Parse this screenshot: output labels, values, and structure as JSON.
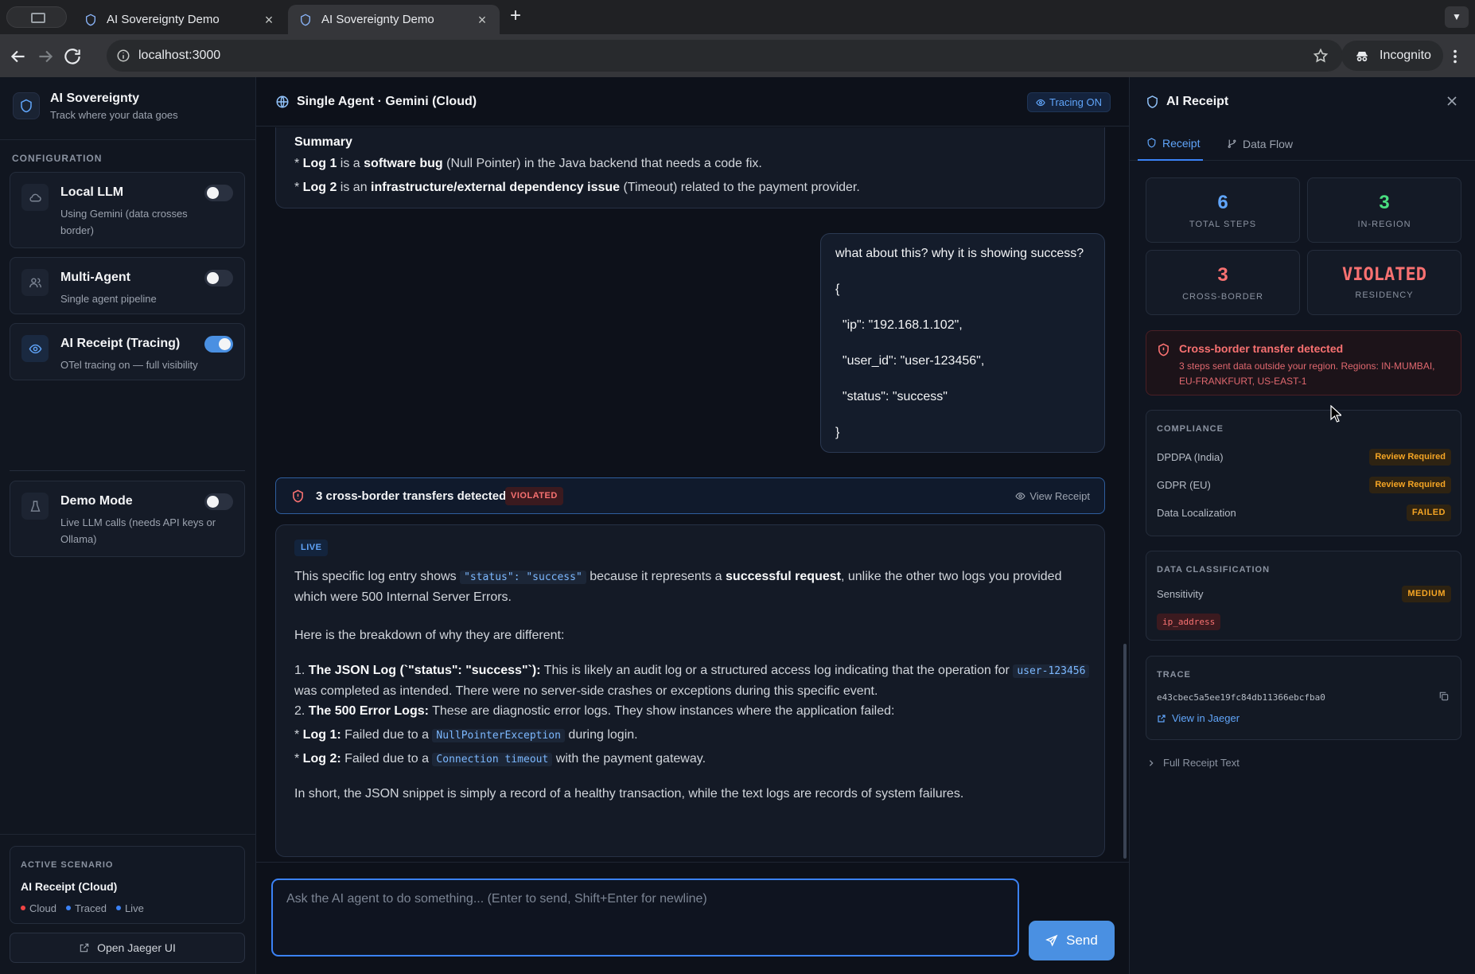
{
  "browser": {
    "tabs": [
      {
        "title": "AI Sovereignty Demo",
        "active": false
      },
      {
        "title": "AI Sovereignty Demo",
        "active": true
      }
    ],
    "url": "localhost:3000",
    "incognito_label": "Incognito"
  },
  "sidebar": {
    "brand_title": "AI Sovereignty",
    "brand_subtitle": "Track where your data goes",
    "section_label": "CONFIGURATION",
    "items": [
      {
        "title": "Local LLM",
        "desc": "Using Gemini (data crosses border)",
        "enabled": false,
        "icon": "cloud-icon"
      },
      {
        "title": "Multi-Agent",
        "desc": "Single agent pipeline",
        "enabled": false,
        "icon": "users-icon"
      },
      {
        "title": "AI Receipt (Tracing)",
        "desc": "OTel tracing on — full visibility",
        "enabled": true,
        "icon": "eye-icon"
      },
      {
        "title": "Demo Mode",
        "desc": "Live LLM calls (needs API keys or Ollama)",
        "enabled": false,
        "icon": "flask-icon"
      }
    ],
    "scenario": {
      "label": "ACTIVE SCENARIO",
      "name": "AI Receipt (Cloud)",
      "tags": [
        "Cloud",
        "Traced",
        "Live"
      ]
    },
    "jaeger_button": "Open Jaeger UI"
  },
  "main": {
    "header_title": "Single Agent · Gemini (Cloud)",
    "tracing_badge": "Tracing ON",
    "top_message": {
      "heading": "Summary",
      "line1_prefix": "* ",
      "line1_b1": "Log 1",
      "line1_t1": " is a ",
      "line1_b2": "software bug",
      "line1_t2": " (Null Pointer) in the Java backend that needs a code fix.",
      "line2_prefix": "* ",
      "line2_b1": "Log 2",
      "line2_t1": " is an ",
      "line2_b2": "infrastructure/external dependency issue",
      "line2_t2": " (Timeout) related to the payment provider."
    },
    "user_message_lines": [
      "what about this? why it is showing success?",
      "{",
      "  \"ip\": \"192.168.1.102\",",
      "  \"user_id\": \"user-123456\",",
      "  \"status\": \"success\"",
      "}"
    ],
    "alert": {
      "text": "3 cross-border transfers detected",
      "badge": "VIOLATED",
      "action": "View Receipt"
    },
    "ai_message": {
      "badge": "LIVE",
      "p1_a": "This specific log entry shows ",
      "p1_code": "\"status\": \"success\"",
      "p1_b": " because it represents a ",
      "p1_bold": "successful request",
      "p1_c": ", unlike the other two logs you provided which were 500 Internal Server Errors.",
      "p2": "Here is the breakdown of why they are different:",
      "p3_num": "1. ",
      "p3_bold": "The JSON Log (`\"status\": \"success\"`):",
      "p3_a": " This is likely an audit log or a structured access log indicating that the operation for ",
      "p3_code": "user-123456",
      "p3_b": " was completed as intended. There were no server-side crashes or exceptions during this specific event.",
      "p4_num": "2. ",
      "p4_bold": "The 500 Error Logs:",
      "p4_a": " These are diagnostic error logs. They show instances where the application failed:",
      "p5_prefix": "* ",
      "p5_bold": "Log 1:",
      "p5_a": " Failed due to a ",
      "p5_code": "NullPointerException",
      "p5_b": " during login.",
      "p6_prefix": "* ",
      "p6_bold": "Log 2:",
      "p6_a": " Failed due to a ",
      "p6_code": "Connection timeout",
      "p6_b": " with the payment gateway.",
      "p7": "In short, the JSON snippet is simply a record of a healthy transaction, while the text logs are records of system failures."
    },
    "composer_placeholder": "Ask the AI agent to do something... (Enter to send, Shift+Enter for newline)",
    "send_label": "Send"
  },
  "panel": {
    "title": "AI Receipt",
    "tabs": [
      "Receipt",
      "Data Flow"
    ],
    "stats": [
      {
        "value": "6",
        "label": "TOTAL STEPS",
        "color": "#60a5fa"
      },
      {
        "value": "3",
        "label": "IN-REGION",
        "color": "#4ade80"
      },
      {
        "value": "3",
        "label": "CROSS-BORDER",
        "color": "#f87171"
      },
      {
        "value": "VIOLATED",
        "label": "RESIDENCY",
        "color": "#f87171"
      }
    ],
    "transfer_alert": {
      "title": "Cross-border transfer detected",
      "desc": "3 steps sent data outside your region. Regions: IN-MUMBAI, EU-FRANKFURT, US-EAST-1"
    },
    "compliance": {
      "label": "COMPLIANCE",
      "rows": [
        {
          "name": "DPDPA (India)",
          "status": "Review Required"
        },
        {
          "name": "GDPR (EU)",
          "status": "Review Required"
        },
        {
          "name": "Data Localization",
          "status": "FAILED"
        }
      ]
    },
    "classification": {
      "label": "DATA CLASSIFICATION",
      "sensitivity_label": "Sensitivity",
      "sensitivity": "MEDIUM",
      "tag": "ip_address"
    },
    "trace": {
      "label": "TRACE",
      "id": "e43cbec5a5ee19fc84db11366ebcfba0",
      "link": "View in Jaeger"
    },
    "full_receipt": "Full Receipt Text"
  }
}
